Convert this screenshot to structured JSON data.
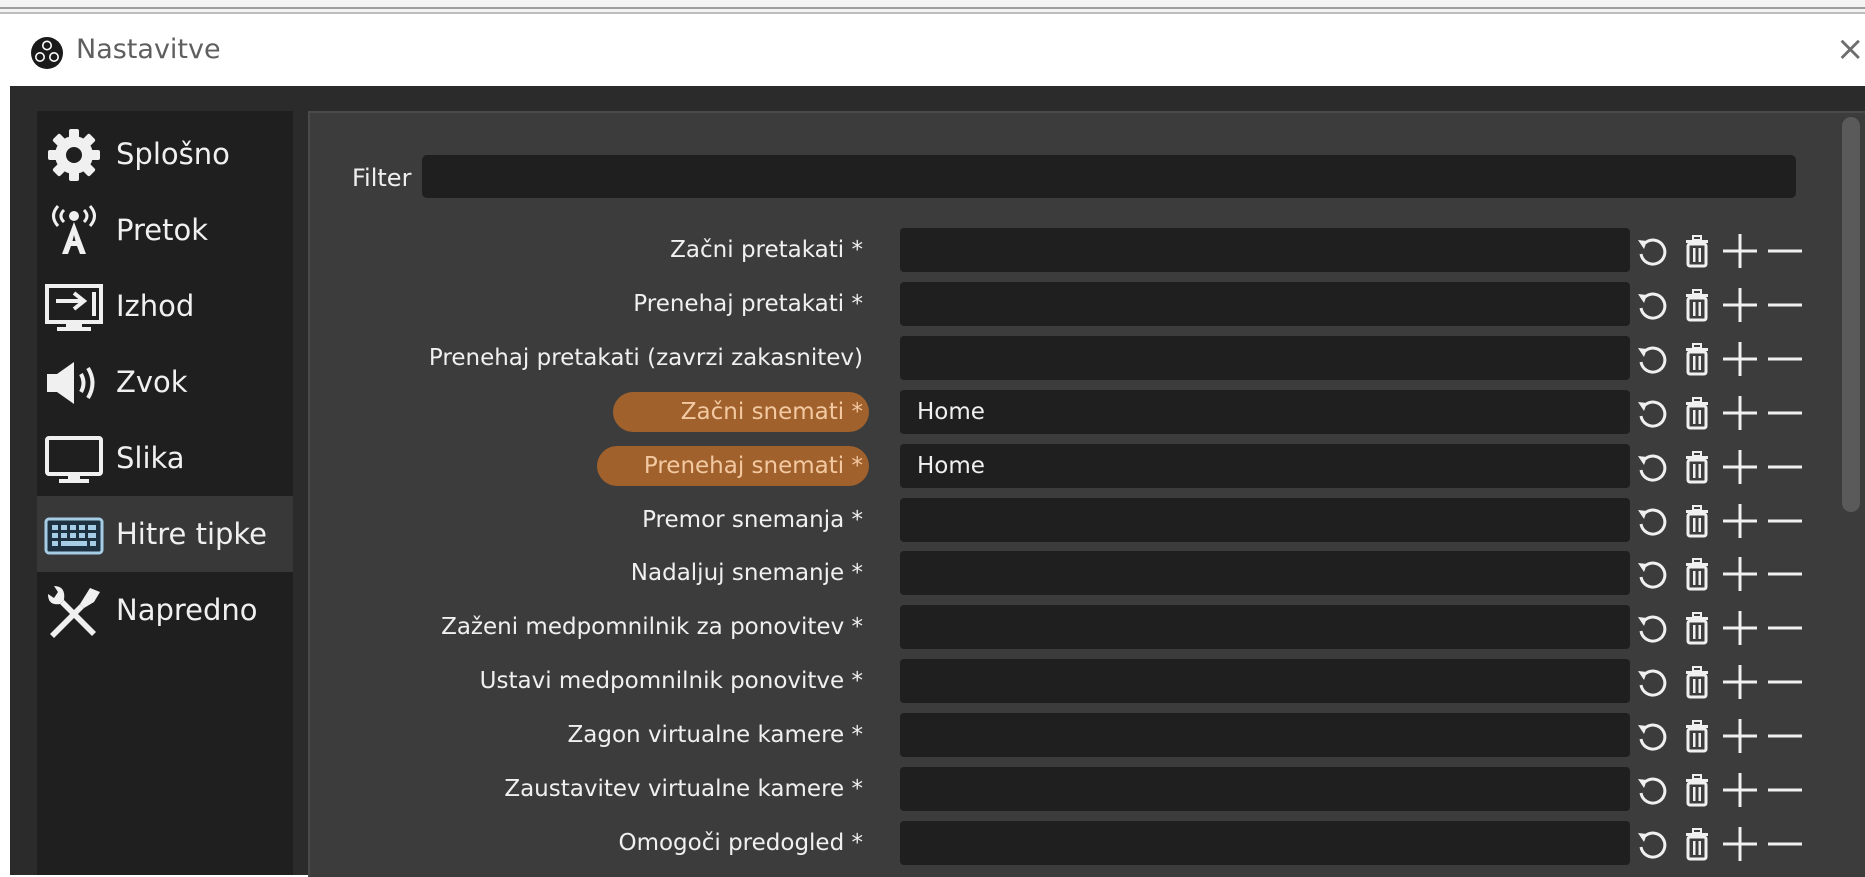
{
  "window": {
    "title": "Nastavitve",
    "close_label": "×"
  },
  "sidebar": {
    "items": [
      {
        "label": "Splošno",
        "icon": "gear-icon",
        "active": false
      },
      {
        "label": "Pretok",
        "icon": "broadcast-antenna-icon",
        "active": false
      },
      {
        "label": "Izhod",
        "icon": "monitor-output-icon",
        "active": false
      },
      {
        "label": "Zvok",
        "icon": "speaker-icon",
        "active": false
      },
      {
        "label": "Slika",
        "icon": "display-icon",
        "active": false
      },
      {
        "label": "Hitre tipke",
        "icon": "keyboard-icon",
        "active": true
      },
      {
        "label": "Napredno",
        "icon": "tools-icon",
        "active": false
      }
    ]
  },
  "filter": {
    "label": "Filter",
    "value": ""
  },
  "hotkeys": [
    {
      "label": "Začni pretakati *",
      "value": "",
      "highlighted": false
    },
    {
      "label": "Prenehaj pretakati *",
      "value": "",
      "highlighted": false
    },
    {
      "label": "Prenehaj pretakati (zavrzi zakasnitev)",
      "value": "",
      "highlighted": false
    },
    {
      "label": "Začni snemati *",
      "value": "Home",
      "highlighted": true
    },
    {
      "label": "Prenehaj snemati *",
      "value": "Home",
      "highlighted": true
    },
    {
      "label": "Premor snemanja *",
      "value": "",
      "highlighted": false
    },
    {
      "label": "Nadaljuj snemanje *",
      "value": "",
      "highlighted": false
    },
    {
      "label": "Zaženi medpomnilnik za ponovitev *",
      "value": "",
      "highlighted": false
    },
    {
      "label": "Ustavi medpomnilnik ponovitve *",
      "value": "",
      "highlighted": false
    },
    {
      "label": "Zagon virtualne kamere *",
      "value": "",
      "highlighted": false
    },
    {
      "label": "Zaustavitev virtualne kamere *",
      "value": "",
      "highlighted": false
    },
    {
      "label": "Omogoči predogled *",
      "value": "",
      "highlighted": false
    }
  ],
  "row_actions": [
    "revert-icon",
    "trash-icon",
    "plus-icon",
    "minus-icon"
  ],
  "colors": {
    "dialog_bg": "#2b2b2b",
    "sidebar_bg": "#1f1f1f",
    "panel_bg": "#3c3c3c",
    "input_bg": "#1f1f1f",
    "highlight": "#a0612c",
    "highlight_text": "#f3c9a2"
  }
}
